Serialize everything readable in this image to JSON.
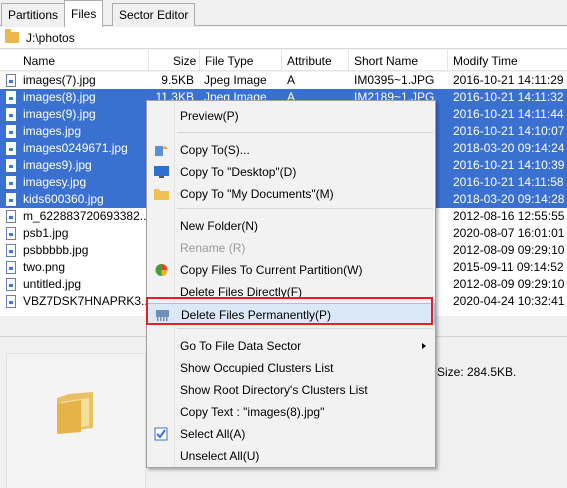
{
  "tabs": [
    {
      "label": "Partitions"
    },
    {
      "label": "Files"
    },
    {
      "label": "Sector Editor"
    }
  ],
  "path": "J:\\photos",
  "columns": {
    "name": "Name",
    "size": "Size",
    "file_type": "File Type",
    "attribute": "Attribute",
    "short_name": "Short Name",
    "modify_time": "Modify Time"
  },
  "rows": [
    {
      "name": "images(7).jpg",
      "size": "9.5KB",
      "type": "Jpeg Image",
      "attr": "A",
      "short": "IM0395~1.JPG",
      "modified": "2016-10-21 14:11:29",
      "selected": false
    },
    {
      "name": "images(8).jpg",
      "size": "11.3KB",
      "type": "Jpeg Image",
      "attr": "A",
      "short": "IM2189~1.JPG",
      "modified": "2016-10-21 14:11:32",
      "selected": true
    },
    {
      "name": "images(9).jpg",
      "size": "",
      "type": "",
      "attr": "",
      "short": "",
      "modified": "2016-10-21 14:11:44",
      "selected": true
    },
    {
      "name": "images.jpg",
      "size": "",
      "type": "",
      "attr": "",
      "short": "",
      "modified": "2016-10-21 14:10:07",
      "selected": true
    },
    {
      "name": "images0249671.jpg",
      "size": "",
      "type": "",
      "attr": "",
      "short": "",
      "modified": "2018-03-20 09:14:24",
      "selected": true
    },
    {
      "name": "images9).jpg",
      "size": "",
      "type": "",
      "attr": "",
      "short": "",
      "modified": "2016-10-21 14:10:39",
      "selected": true
    },
    {
      "name": "imagesy.jpg",
      "size": "",
      "type": "",
      "attr": "",
      "short": "",
      "modified": "2016-10-21 14:11:58",
      "selected": true
    },
    {
      "name": "kids600360.jpg",
      "size": "",
      "type": "",
      "attr": "",
      "short": "",
      "modified": "2018-03-20 09:14:28",
      "selected": true
    },
    {
      "name": "m_622883720693382...",
      "size": "",
      "type": "",
      "attr": "",
      "short": "",
      "modified": "2012-08-16 12:55:55",
      "selected": false
    },
    {
      "name": "psb1.jpg",
      "size": "",
      "type": "",
      "attr": "",
      "short": "",
      "modified": "2020-08-07 16:01:01",
      "selected": false
    },
    {
      "name": "psbbbbb.jpg",
      "size": "",
      "type": "",
      "attr": "",
      "short": "",
      "modified": "2012-08-09 09:29:10",
      "selected": false
    },
    {
      "name": "two.png",
      "size": "",
      "type": "",
      "attr": "",
      "short": "",
      "modified": "2015-09-11 09:14:52",
      "selected": false
    },
    {
      "name": "untitled.jpg",
      "size": "",
      "type": "",
      "attr": "",
      "short": "",
      "modified": "2012-08-09 09:29:10",
      "selected": false
    },
    {
      "name": "VBZ7DSK7HNAPRK3...",
      "size": "",
      "type": "",
      "attr": "",
      "short": "",
      "modified": "2020-04-24 10:32:41",
      "selected": false
    }
  ],
  "size_info": "Size: 284.5KB.",
  "menu": {
    "items": [
      {
        "label": "Preview(P)",
        "icon": "",
        "disabled": false,
        "highlight": false,
        "submenu": false
      },
      {
        "label": "Copy To(S)...",
        "icon": "copy-icon",
        "disabled": false,
        "highlight": false,
        "submenu": false
      },
      {
        "label": "Copy To \"Desktop\"(D)",
        "icon": "desktop-icon",
        "disabled": false,
        "highlight": false,
        "submenu": false
      },
      {
        "label": "Copy To \"My Documents\"(M)",
        "icon": "folder-icon",
        "disabled": false,
        "highlight": false,
        "submenu": false
      },
      {
        "label": "New Folder(N)",
        "icon": "",
        "disabled": false,
        "highlight": false,
        "submenu": false
      },
      {
        "label": "Rename (R)",
        "icon": "",
        "disabled": true,
        "highlight": false,
        "submenu": false
      },
      {
        "label": "Copy Files To Current Partition(W)",
        "icon": "pie-icon",
        "disabled": false,
        "highlight": false,
        "submenu": false
      },
      {
        "label": "Delete Files Directly(F)",
        "icon": "",
        "disabled": false,
        "highlight": false,
        "submenu": false
      },
      {
        "label": "Delete Files Permanently(P)",
        "icon": "shredder-icon",
        "disabled": false,
        "highlight": true,
        "submenu": false
      },
      {
        "label": "Go To File Data Sector",
        "icon": "",
        "disabled": false,
        "highlight": false,
        "submenu": true
      },
      {
        "label": "Show Occupied Clusters List",
        "icon": "",
        "disabled": false,
        "highlight": false,
        "submenu": false
      },
      {
        "label": "Show Root Directory's Clusters List",
        "icon": "",
        "disabled": false,
        "highlight": false,
        "submenu": false
      },
      {
        "label": "Copy Text : \"images(8).jpg\"",
        "icon": "",
        "disabled": false,
        "highlight": false,
        "submenu": false
      },
      {
        "label": "Select All(A)",
        "icon": "checkbox-icon",
        "disabled": false,
        "highlight": false,
        "submenu": false
      },
      {
        "label": "Unselect All(U)",
        "icon": "",
        "disabled": false,
        "highlight": false,
        "submenu": false
      }
    ]
  },
  "colors": {
    "selection": "#3a71d0",
    "highlight_border": "#e02222"
  }
}
